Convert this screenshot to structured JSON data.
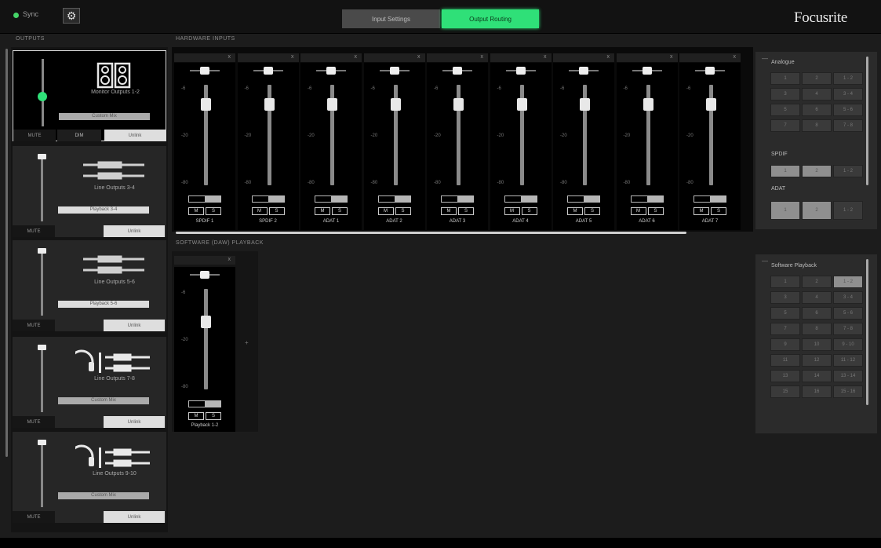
{
  "topbar": {
    "sync_label": "Sync",
    "settings_icon": "gear-icon",
    "tabs": [
      {
        "label": "Input Settings",
        "active": false
      },
      {
        "label": "Output Routing",
        "active": true
      }
    ],
    "brand": "Focusrite"
  },
  "sections": {
    "outputs": "OUTPUTS",
    "hardware_inputs": "HARDWARE INPUTS",
    "software_playback": "SOFTWARE (DAW) PLAYBACK"
  },
  "outputs": [
    {
      "name": "Monitor Outputs 1-2",
      "mix": "Custom Mix",
      "icon": "speakers-icon",
      "selected": true,
      "mute": "MUTE",
      "dim": "DIM",
      "link": "Unlink",
      "level": 0.72
    },
    {
      "name": "Line Outputs 3-4",
      "mix": "Playback 3-4",
      "icon": "line-cable-icon",
      "selected": false,
      "mute": "MUTE",
      "link": "Unlink",
      "level": 1.0
    },
    {
      "name": "Line Outputs 5-6",
      "mix": "Playback 5-6",
      "icon": "line-cable-icon",
      "selected": false,
      "mute": "MUTE",
      "link": "Unlink",
      "level": 1.0
    },
    {
      "name": "Line Outputs 7-8",
      "mix": "Custom Mix",
      "icon": "headphones-icon",
      "selected": false,
      "mute": "MUTE",
      "link": "Unlink",
      "level": 1.0
    },
    {
      "name": "Line Outputs 9-10",
      "mix": "Custom Mix",
      "icon": "headphones-icon",
      "selected": false,
      "mute": "MUTE",
      "link": "Unlink",
      "level": 1.0
    }
  ],
  "fader_scale": [
    "0",
    "-6",
    "-20",
    "-80"
  ],
  "hardware_inputs": [
    {
      "name": "SPDIF 1",
      "close": "x",
      "m": "M",
      "s": "S"
    },
    {
      "name": "SPDIF 2",
      "close": "x",
      "m": "M",
      "s": "S"
    },
    {
      "name": "ADAT 1",
      "close": "x",
      "m": "M",
      "s": "S"
    },
    {
      "name": "ADAT 2",
      "close": "x",
      "m": "M",
      "s": "S"
    },
    {
      "name": "ADAT 3",
      "close": "x",
      "m": "M",
      "s": "S"
    },
    {
      "name": "ADAT 4",
      "close": "x",
      "m": "M",
      "s": "S"
    },
    {
      "name": "ADAT 5",
      "close": "x",
      "m": "M",
      "s": "S"
    },
    {
      "name": "ADAT 6",
      "close": "x",
      "m": "M",
      "s": "S"
    },
    {
      "name": "ADAT 7",
      "close": "x",
      "m": "M",
      "s": "S"
    }
  ],
  "software_playback": [
    {
      "name": "Playback 1-2",
      "close": "x",
      "m": "M",
      "s": "S"
    }
  ],
  "analogue_panel": {
    "title": "Analogue",
    "rows": [
      [
        "1",
        "2",
        "1 - 2"
      ],
      [
        "3",
        "4",
        "3 - 4"
      ],
      [
        "5",
        "6",
        "5 - 6"
      ],
      [
        "7",
        "8",
        "7 - 8"
      ]
    ],
    "spdif_label": "SPDIF",
    "spdif_row": [
      "1",
      "2",
      "1 - 2"
    ],
    "adat_label": "ADAT",
    "adat_row": [
      "1",
      "2",
      "1 - 2"
    ]
  },
  "playback_panel": {
    "title": "Software Playback",
    "rows": [
      [
        "1",
        "2",
        "1 - 2"
      ],
      [
        "3",
        "4",
        "3 - 4"
      ],
      [
        "5",
        "6",
        "5 - 6"
      ],
      [
        "7",
        "8",
        "7 - 8"
      ],
      [
        "9",
        "10",
        "9 - 10"
      ],
      [
        "11",
        "12",
        "11 - 12"
      ],
      [
        "13",
        "14",
        "13 - 14"
      ],
      [
        "15",
        "16",
        "15 - 16"
      ]
    ]
  }
}
